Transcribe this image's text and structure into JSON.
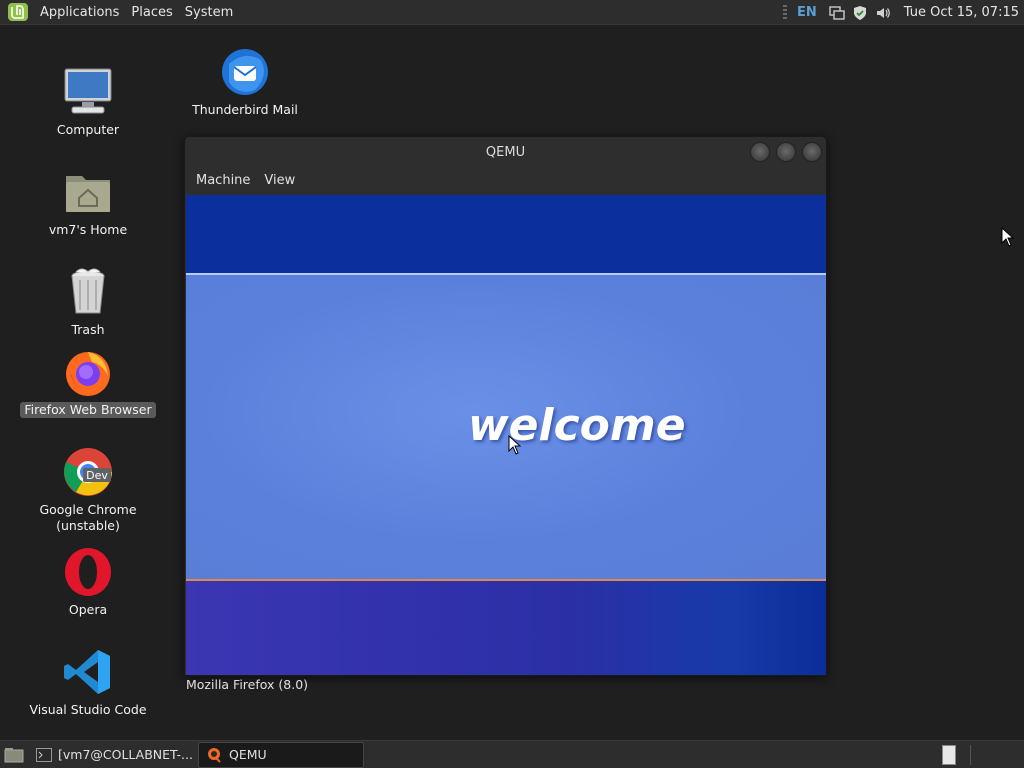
{
  "top_panel": {
    "menus": [
      "Applications",
      "Places",
      "System"
    ],
    "language": "EN",
    "clock": "Tue Oct 15, 07:15"
  },
  "desktop_icons": [
    {
      "label": "Computer"
    },
    {
      "label": "Thunderbird Mail"
    },
    {
      "label": "vm7's Home"
    },
    {
      "label": "Trash"
    },
    {
      "label": "Firefox Web Browser"
    },
    {
      "label": "Google Chrome\n(unstable)"
    },
    {
      "label": "Opera"
    },
    {
      "label": "Visual Studio Code"
    }
  ],
  "chrome_badge": "Dev",
  "qemu": {
    "title": "QEMU",
    "menus": [
      "Machine",
      "View"
    ],
    "guest_welcome": "welcome",
    "status": "Mozilla Firefox (8.0)"
  },
  "taskbar": {
    "items": [
      "[vm7@COLLABNET-...",
      "QEMU"
    ]
  },
  "colors": {
    "panel": "#2d2d2d",
    "guest_top_band": "#0b2f9c",
    "guest_mid": "#5b80dc",
    "guest_bottom": "#2b2fa6"
  }
}
